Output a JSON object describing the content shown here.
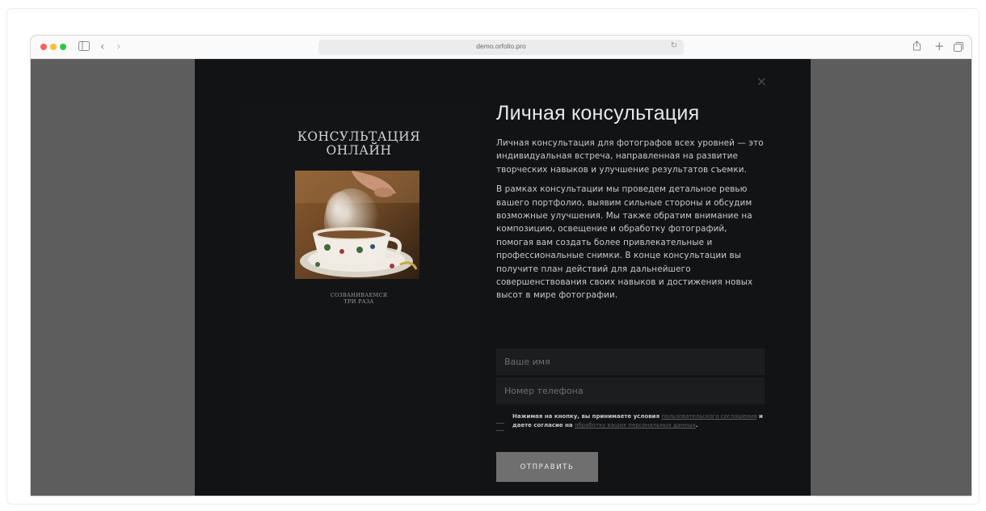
{
  "browser": {
    "url": "demo.orfolio.pro",
    "traffic_lights": [
      "#ff5f57",
      "#febc2e",
      "#28c840"
    ],
    "icons": [
      "sidebar-icon",
      "back-icon",
      "forward-icon",
      "reload-icon",
      "share-icon",
      "new-tab-icon",
      "tabs-icon"
    ]
  },
  "modal": {
    "close_label": "×",
    "cover": {
      "title_line1": "КОНСУЛЬТАЦИЯ",
      "title_line2": "ОНЛАЙН",
      "sub_line1": "СОЗВАНИВАЕМСЯ",
      "sub_line2": "ТРИ РАЗА"
    },
    "heading": "Личная консультация",
    "paragraph1": "Личная консультация для фотографов всех уровней — это индивидуальная встреча, направленная на развитие творческих навыков и улучшение результатов съемки.",
    "paragraph2": "В рамках консультации мы проведем детальное ревью вашего портфолио, выявим сильные стороны и обсудим возможные улучшения. Мы также обратим внимание на композицию, освещение и обработку фотографий, помогая вам создать более привлекательные и профессиональные снимки. В конце консультации вы получите план действий для дальнейшего совершенствования своих навыков и достижения новых высот в мире фотографии.",
    "form": {
      "name_placeholder": "Ваше имя",
      "phone_placeholder": "Номер телефона",
      "consent_prefix": "Нажимая на кнопку, вы принимаете условия ",
      "consent_link1": "пользовательского соглашения",
      "consent_middle": " и даете согласие на ",
      "consent_link2": "обработку ваших персональных данных",
      "consent_suffix": ".",
      "submit_label": "ОТПРАВИТЬ"
    }
  }
}
